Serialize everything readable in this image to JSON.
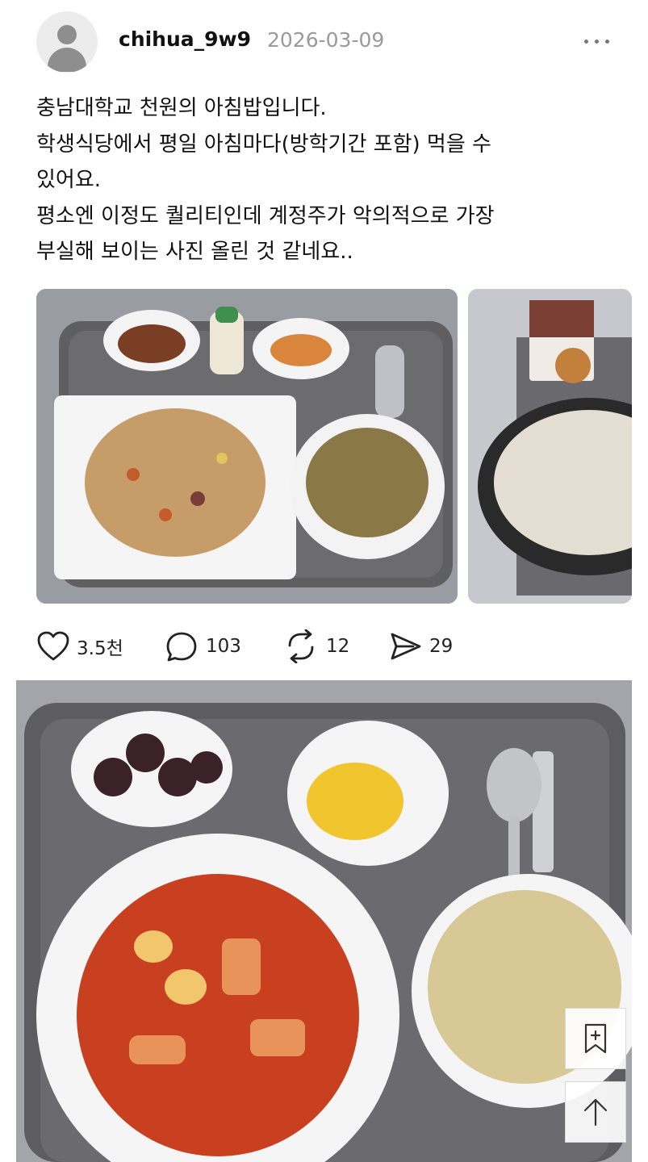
{
  "post": {
    "username": "chihua_9w9",
    "date": "2026-03-09",
    "text": "충남대학교 천원의 아침밥입니다.\n학생식당에서 평일 아침마다(방학기간 포함) 먹을 수\n있어요.\n평소엔 이정도 퀄리티인데 계정주가 악의적으로 가장\n부실해 보이는 사진 올린 것 같네요.."
  },
  "actions": {
    "likes": "3.5천",
    "comments": "103",
    "reposts": "12",
    "shares": "29"
  },
  "icons": {
    "avatar": "user-avatar-icon",
    "more": "more-dots-icon",
    "like": "heart-icon",
    "comment": "comment-bubble-icon",
    "repost": "repost-arrows-icon",
    "share": "send-icon",
    "bookmark": "bookmark-icon",
    "scroll_top": "arrow-up-icon"
  },
  "colors": {
    "date": "#9a9a9a",
    "text": "#111111"
  }
}
